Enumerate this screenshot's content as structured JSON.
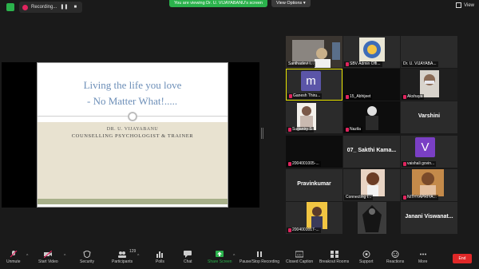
{
  "top": {
    "recording": "Recording...",
    "viewing": "You are viewing Dr. U. VIJAYABANU's screen",
    "view_options": "View Options",
    "view": "View"
  },
  "slide": {
    "title_line1": "Living the life you love",
    "title_line2": "- No Matter What!.....",
    "name": "DR. U. VIJAYABANU",
    "role": "COUNSELLING PSYCHOLOGIST & TRAINER",
    "colors": {
      "title": "#6d8fb8",
      "band": "#e8e2d0",
      "footer": "#a8b08a"
    }
  },
  "gallery": {
    "tiles": [
      {
        "label": "Santhadevi I...",
        "muted": false
      },
      {
        "label": "SBV Admin Offi...",
        "muted": true
      },
      {
        "label": "Dr. U. VIJAYABA...",
        "muted": false
      },
      {
        "label": "Ganesh Thiru...",
        "muted": true,
        "avatar": "m",
        "avatar_color": "#5b55a8",
        "active": true
      },
      {
        "label": "15_Abhijeet",
        "muted": true
      },
      {
        "label": "Akshaya",
        "muted": true
      },
      {
        "label": "Sugantry S",
        "muted": true
      },
      {
        "label": "Nazila",
        "muted": true
      },
      {
        "label": "Varshini",
        "muted": false,
        "center": true
      },
      {
        "label": "2004001005-...",
        "muted": true
      },
      {
        "label": "07_ Sakthi Kama...",
        "muted": false,
        "center": true
      },
      {
        "label": "vaishali govin...",
        "muted": true,
        "avatar": "V",
        "avatar_color": "#7a3fc4"
      },
      {
        "label": "Pravinkumar",
        "muted": false,
        "center": true
      },
      {
        "label": "Connecting t...",
        "muted": true
      },
      {
        "label": "NITHYAPRIYA...",
        "muted": true
      },
      {
        "label": "2004001017-...",
        "muted": true
      },
      {
        "label": "",
        "muted": false
      },
      {
        "label": "Janani Viswanat...",
        "muted": false,
        "center": true
      }
    ]
  },
  "toolbar": {
    "unmute": "Unmute",
    "start_video": "Start Video",
    "security": "Security",
    "participants": "Participants",
    "participants_count": "129",
    "polls": "Polls",
    "chat": "Chat",
    "share_screen": "Share Screen",
    "pause_recording": "Pause/Stop Recording",
    "closed_caption": "Closed Caption",
    "breakout_rooms": "Breakout Rooms",
    "support": "Support",
    "reactions": "Reactions",
    "more": "More",
    "end": "End",
    "accent": "#2bb24c",
    "end_color": "#e02828"
  }
}
